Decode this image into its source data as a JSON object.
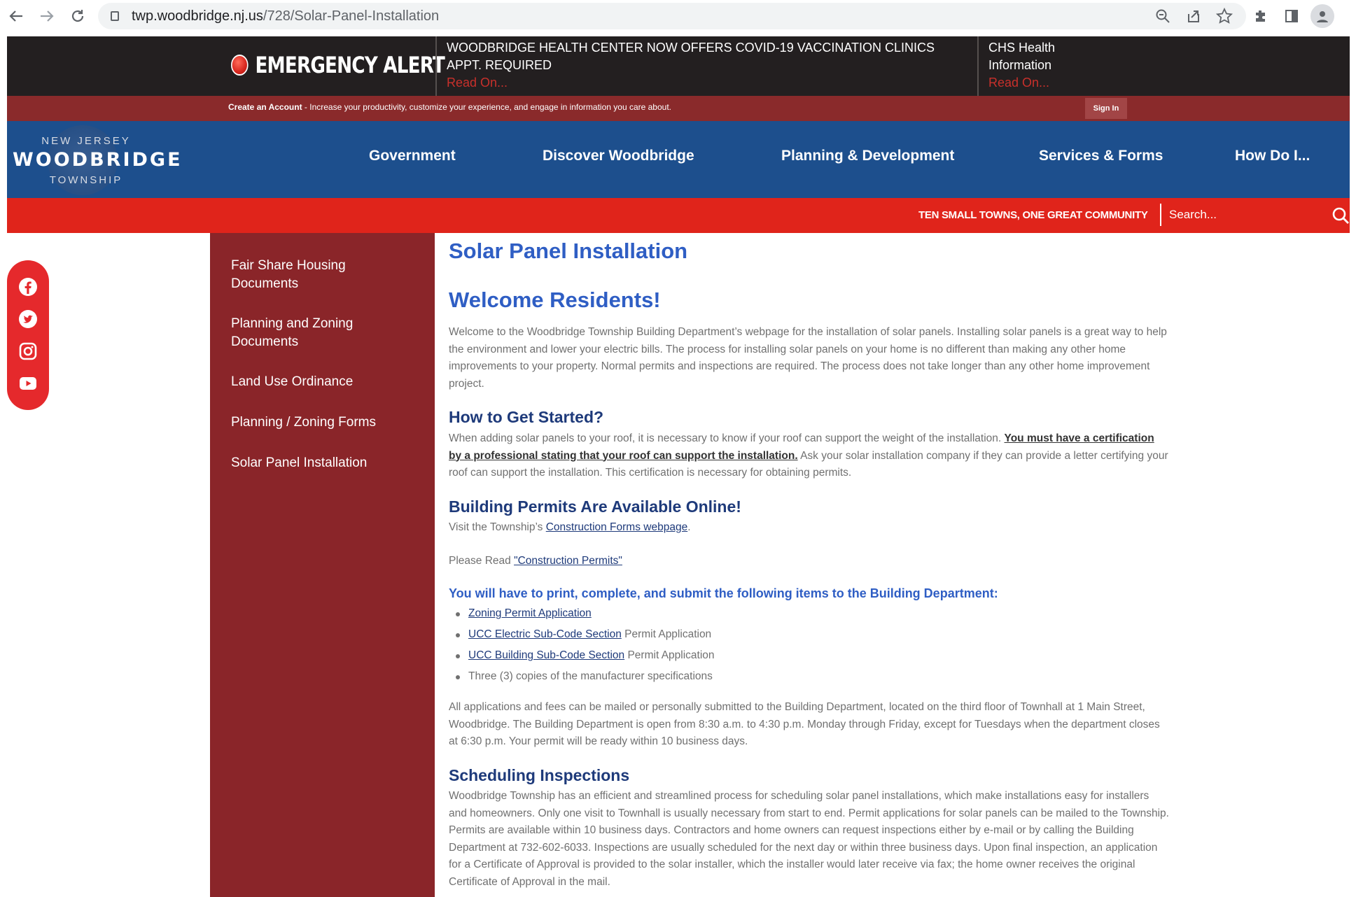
{
  "browser": {
    "url_host": "twp.woodbridge.nj.us",
    "url_path": "/728/Solar-Panel-Installation"
  },
  "alert": {
    "title": "EMERGENCY ALERT",
    "item1_text": "WOODBRIDGE HEALTH CENTER NOW OFFERS COVID-19 VACCINATION CLINICS APPT. REQUIRED",
    "item1_link": "Read On...",
    "item2_text": "CHS Health Information",
    "item2_link": "Read On..."
  },
  "account": {
    "create_label": "Create an Account",
    "create_desc": " - Increase your productivity, customize your experience, and engage in information you care about.",
    "signin": "Sign In"
  },
  "logo": {
    "top": "NEW JERSEY",
    "main": "WOODBRIDGE",
    "bottom": "TOWNSHIP"
  },
  "nav": {
    "items": [
      "Government",
      "Discover Woodbridge",
      "Planning & Development",
      "Services & Forms",
      "How Do I..."
    ]
  },
  "tagline": "TEN SMALL TOWNS, ONE GREAT COMMUNITY",
  "search": {
    "placeholder": "Search..."
  },
  "social": [
    "facebook-icon",
    "twitter-icon",
    "instagram-icon",
    "youtube-icon"
  ],
  "sidebar": {
    "items": [
      {
        "label": "Fair Share Housing Documents"
      },
      {
        "label": "Planning and Zoning Documents"
      },
      {
        "label": "Land Use Ordinance"
      },
      {
        "label": "Planning / Zoning Forms"
      },
      {
        "label": "Solar Panel Installation"
      }
    ]
  },
  "content": {
    "page_title": "Solar Panel Installation",
    "welcome": "Welcome Residents!",
    "welcome_para": "Welcome to the Woodbridge Township Building Department’s webpage for the installation of solar panels. Installing solar panels is a great way to help the environment and lower your electric bills. The process for installing solar panels on your home is no different than making any other home improvements to your property. Normal permits and inspections are required. The process does not take longer than any other home improvement project.",
    "started_heading": "How to Get Started?",
    "started_pre": "When adding solar panels to your roof, it is necessary to know if your roof can support the weight of the installation. ",
    "started_link": "You must have a certification by a professional stating that your roof can support the installation.",
    "started_post": " Ask your solar installation company if they can provide a letter certifying your roof can support the installation. This certification is necessary for obtaining permits.",
    "permits_heading": "Building Permits Are Available Online!",
    "permits_pre": "Visit the Township’s ",
    "permits_link": "Construction Forms webpage",
    "permits_post": ".",
    "read_pre": "Please Read ",
    "read_link": "\"Construction Permits\"",
    "print_heading": "You will have to print, complete, and submit the following items to the Building Department:",
    "list": {
      "item1_link": "Zoning Permit Application",
      "item2_link": "UCC Electric Sub-Code Section",
      "item2_text": " Permit Application",
      "item3_link": "UCC Building Sub-Code Section",
      "item3_text": " Permit Application",
      "item4_text": "Three (3) copies of the manufacturer specifications"
    },
    "mail_para": "All applications and fees can be mailed or personally submitted to the Building Department, located on the third floor of Townhall at 1 Main Street, Woodbridge. The Building Department is open from 8:30 a.m. to 4:30 p.m. Monday through Friday, except for Tuesdays when the department closes at 6:30 p.m. Your permit will be ready within 10 business days.",
    "sched_heading": "Scheduling Inspections",
    "sched_para": "Woodbridge Township has an efficient and streamlined process for scheduling solar panel installations, which make installations easy for installers and homeowners.  Only one visit to Townhall is usually necessary from start to end.  Permit applications for solar panels can be mailed to the Township. Permits are available within 10 business days. Contractors and home owners can request inspections either by e-mail or by calling the Building Department at 732-602-6033. Inspections are usually scheduled for the next day or within three business days.  Upon final inspection, an application for a Certificate of Approval is provided to the solar installer, which the installer would later receive via fax; the home owner receives the original Certificate of Approval in the mail."
  },
  "colors": {
    "alert_bg": "#231f20",
    "account_bg": "#8a2a2b",
    "nav_bg": "#1d4f8d",
    "tagline_bg": "#e0241b",
    "sidebar_bg": "#8a2529",
    "heading_blue": "#2f5ec4"
  }
}
